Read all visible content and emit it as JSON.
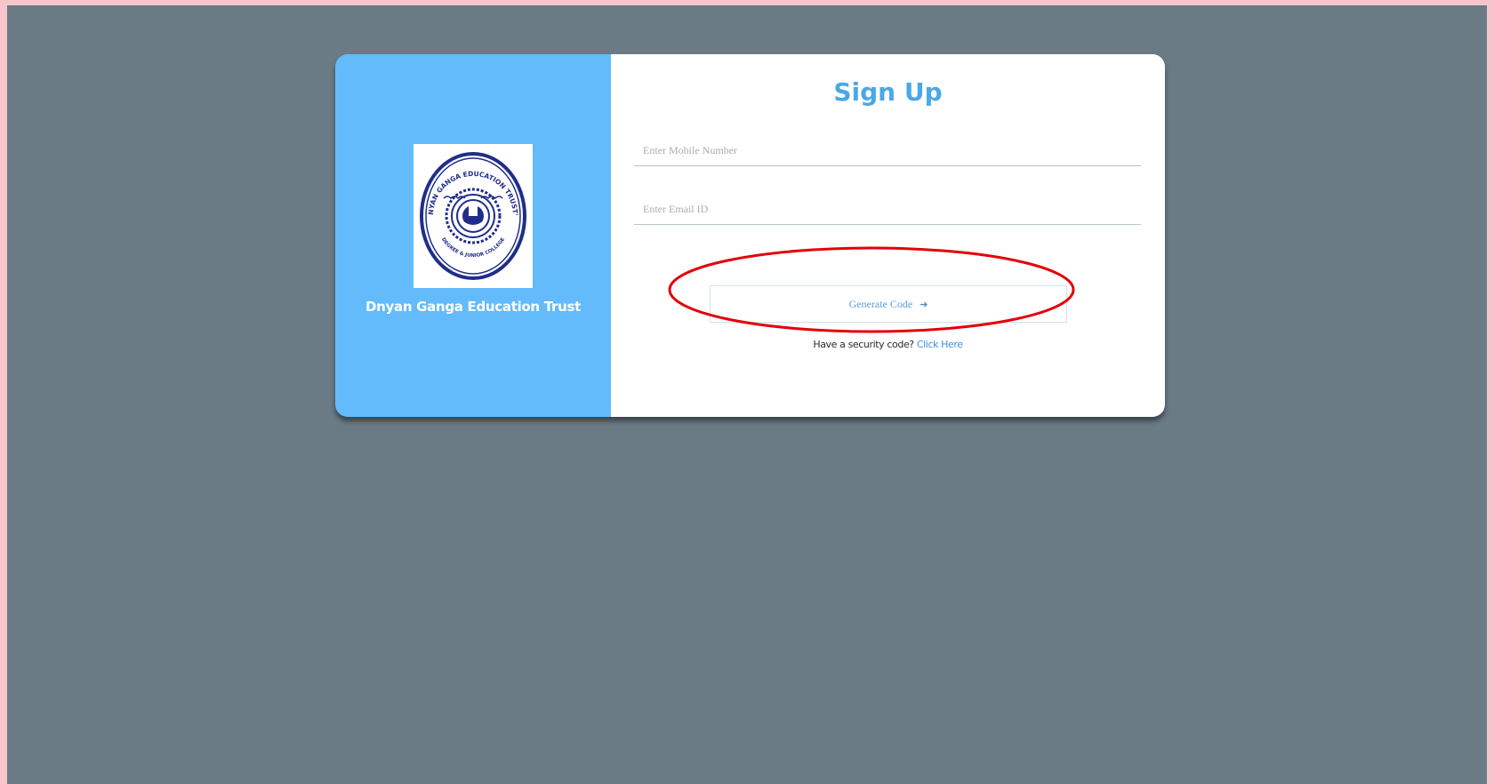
{
  "org": {
    "name": "Dnyan Ganga Education Trust",
    "logo_text_top": "DNYAN GANGA EDUCATION TRUST'S",
    "logo_text_bottom": "DEGREE & JUNIOR COLLEGE"
  },
  "form": {
    "title": "Sign Up",
    "mobile_placeholder": "Enter Mobile Number",
    "email_placeholder": "Enter Email ID",
    "generate_label": "Generate Code",
    "generate_icon": "sign-in-icon",
    "security_prompt": "Have a security code?",
    "security_link": "Click Here"
  },
  "colors": {
    "page_border": "#f7c6cc",
    "background": "#6a7b85",
    "left_panel": "#63bbfb",
    "title": "#4aa8e8",
    "link": "#3d8fe0",
    "annotation": "#e3000b"
  }
}
